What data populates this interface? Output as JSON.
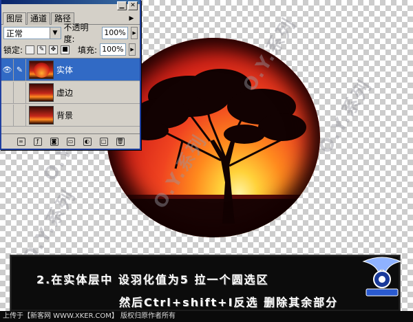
{
  "watermark": "O.Y.系列",
  "layers_panel": {
    "tabs": [
      "图层",
      "通道",
      "路径"
    ],
    "blend_mode": "正常",
    "opacity_label": "不透明度:",
    "opacity_value": "100%",
    "lock_label": "锁定:",
    "fill_label": "填充:",
    "fill_value": "100%",
    "layers": [
      {
        "name": "实体",
        "selected": true,
        "visible": true
      },
      {
        "name": "虚边",
        "selected": false,
        "visible": false
      },
      {
        "name": "背景",
        "selected": false,
        "visible": false
      }
    ]
  },
  "caption": {
    "line1": "2.在实体层中 设羽化值为5 拉一个圆选区",
    "line2": "然后Ctrl+shift+I反选 删除其余部分"
  },
  "footer": {
    "text": "上传于【新客网 WWW.XKER.COM】 版权归原作者所有"
  },
  "colors": {
    "accent_selected": "#316ac5",
    "titlebar": "#0a246a",
    "caption_bg": "#0c0c0c"
  },
  "icons": [
    "eye-icon",
    "brush-icon",
    "lock-transparency-icon",
    "lock-paint-icon",
    "lock-move-icon",
    "lock-all-icon",
    "link-icon",
    "add-style-icon",
    "add-mask-icon",
    "new-group-icon",
    "adjustment-icon",
    "new-layer-icon",
    "trash-icon"
  ]
}
